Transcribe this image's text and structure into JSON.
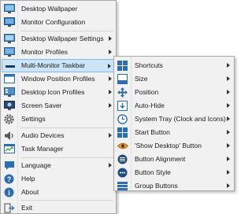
{
  "main_menu": {
    "items": [
      {
        "label": "Desktop Wallpaper",
        "icon": "desktop-wallpaper-icon",
        "submenu": false
      },
      {
        "label": "Monitor Configuration",
        "icon": "monitor-configuration-icon",
        "submenu": false
      },
      {
        "label": "Desktop Wallpaper Settings",
        "icon": "wallpaper-settings-icon",
        "submenu": true
      },
      {
        "label": "Monitor Profiles",
        "icon": "monitor-profiles-icon",
        "submenu": true
      },
      {
        "label": "Multi-Monitor Taskbar",
        "icon": "taskbar-icon",
        "submenu": true,
        "highlighted": true
      },
      {
        "label": "Window Position Profiles",
        "icon": "window-position-icon",
        "submenu": true
      },
      {
        "label": "Desktop Icon Profiles",
        "icon": "desktop-icon-profiles-icon",
        "submenu": true
      },
      {
        "label": "Screen Saver",
        "icon": "screen-saver-icon",
        "submenu": true
      },
      {
        "label": "Settings",
        "icon": "settings-gear-icon",
        "submenu": false
      },
      {
        "label": "Audio Devices",
        "icon": "audio-speaker-icon",
        "submenu": true
      },
      {
        "label": "Task Manager",
        "icon": "task-manager-icon",
        "submenu": false
      },
      {
        "label": "Language",
        "icon": "language-icon",
        "submenu": true
      },
      {
        "label": "Help",
        "icon": "help-icon",
        "submenu": false
      },
      {
        "label": "About",
        "icon": "about-info-icon",
        "submenu": false
      },
      {
        "label": "Exit",
        "icon": "exit-icon",
        "submenu": false
      }
    ]
  },
  "sub_menu": {
    "items": [
      {
        "label": "Shortcuts",
        "icon": "shortcuts-grid-icon"
      },
      {
        "label": "Size",
        "icon": "size-icon"
      },
      {
        "label": "Position",
        "icon": "position-arrows-icon"
      },
      {
        "label": "Auto-Hide",
        "icon": "auto-hide-icon"
      },
      {
        "label": "System Tray (Clock and Icons)",
        "icon": "clock-icon"
      },
      {
        "label": "Start Button",
        "icon": "start-button-icon"
      },
      {
        "label": "'Show Desktop' Button",
        "icon": "show-desktop-eye-icon"
      },
      {
        "label": "Button Alignment",
        "icon": "button-alignment-icon"
      },
      {
        "label": "Button Style",
        "icon": "button-style-icon"
      },
      {
        "label": "Group Buttons",
        "icon": "group-buttons-icon"
      }
    ]
  },
  "colors": {
    "menu_bg": "#f1f1f1",
    "highlight_bg": "#cce4f7",
    "highlight_border": "#86b8e3",
    "icon_blue": "#2e6db4"
  }
}
